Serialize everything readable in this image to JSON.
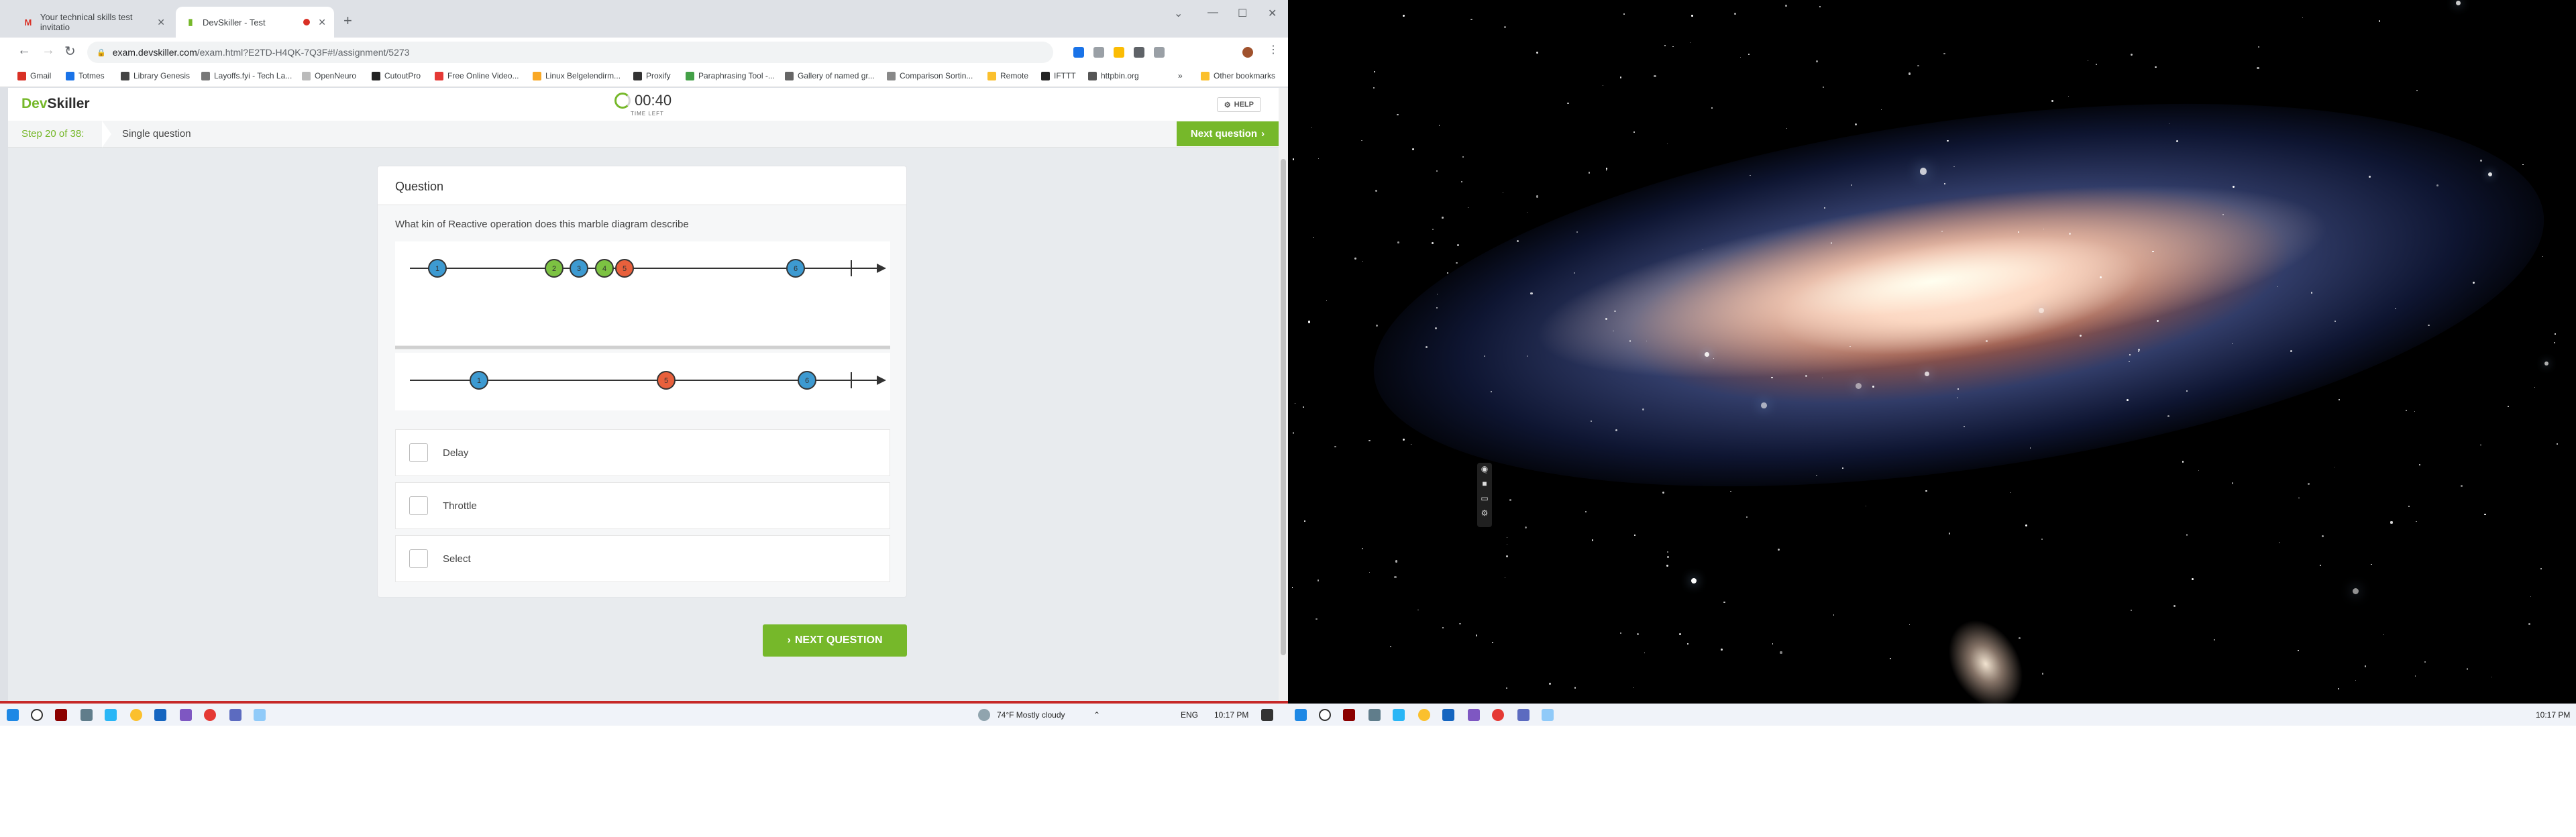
{
  "browser": {
    "tabs": [
      {
        "label": "Your technical skills test invitatio",
        "icon": "gmail-icon"
      },
      {
        "label": "DevSkiller - Test",
        "icon": "devskiller-icon"
      }
    ],
    "url_host": "exam.devskiller.com",
    "url_path": "/exam.html?E2TD-H4QK-7Q3F#!/assignment/5273",
    "bookmarks": [
      "Gmail",
      "Totmes",
      "Library Genesis",
      "Layoffs.fyi - Tech La...",
      "OpenNeuro",
      "CutoutPro",
      "Free Online Video...",
      "Linux Belgelendirm...",
      "Proxify",
      "Paraphrasing Tool -...",
      "Gallery of named gr...",
      "Comparison Sortin...",
      "Remote",
      "IFTTT",
      "httpbin.org"
    ],
    "other_bookmarks": "Other bookmarks"
  },
  "exam": {
    "logo_dev": "Dev",
    "logo_skiller": "Skiller",
    "timer": "00:40",
    "timer_label": "TIME LEFT",
    "help": "HELP",
    "step": "Step 20 of 38:",
    "step_title": "Single question",
    "next_question_top": "Next question",
    "card_title": "Question",
    "question": "What kin of Reactive operation does this marble diagram describe",
    "marbles_top": [
      {
        "label": "1",
        "color": "#3d9ad1"
      },
      {
        "label": "2",
        "color": "#7cc242"
      },
      {
        "label": "3",
        "color": "#3d9ad1"
      },
      {
        "label": "4",
        "color": "#7cc242"
      },
      {
        "label": "5",
        "color": "#e8603c"
      },
      {
        "label": "6",
        "color": "#3d9ad1"
      }
    ],
    "marbles_bottom": [
      {
        "label": "1",
        "color": "#3d9ad1"
      },
      {
        "label": "5",
        "color": "#e8603c"
      },
      {
        "label": "6",
        "color": "#3d9ad1"
      }
    ],
    "answers": [
      "Delay",
      "Throttle",
      "Select"
    ],
    "next_button": "NEXT QUESTION"
  },
  "taskbar_left": {
    "weather": "74°F  Mostly cloudy",
    "lang": "ENG",
    "time": "10:17 PM"
  },
  "taskbar_right": {
    "time": "10:17 PM"
  }
}
